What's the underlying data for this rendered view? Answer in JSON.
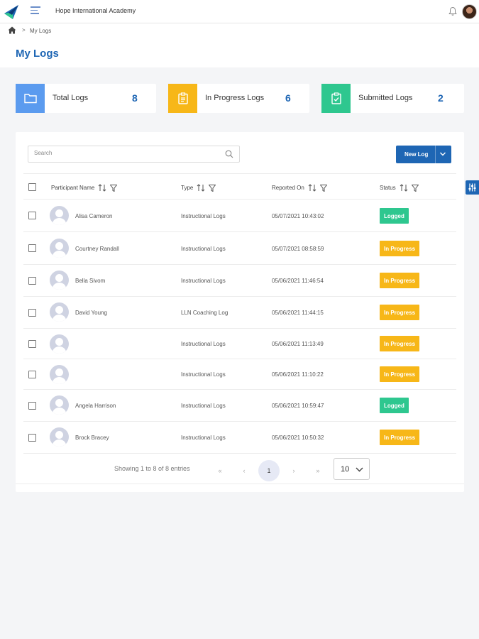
{
  "app": {
    "title": "Hope International Academy"
  },
  "breadcrumb": {
    "separator": ">",
    "current": "My Logs"
  },
  "page": {
    "title": "My Logs"
  },
  "stats": [
    {
      "label": "Total Logs",
      "value": "8",
      "color": "#5b9bef",
      "icon": "folder-icon"
    },
    {
      "label": "In Progress Logs",
      "value": "6",
      "color": "#f7b718",
      "icon": "clipboard-icon"
    },
    {
      "label": "Submitted Logs",
      "value": "2",
      "color": "#2ec78f",
      "icon": "clipboard-check-icon"
    }
  ],
  "search": {
    "placeholder": "Search"
  },
  "toolbar": {
    "new_log_label": "New Log"
  },
  "table": {
    "columns": [
      "Participant Name",
      "Type",
      "Reported On",
      "Status"
    ],
    "rows": [
      {
        "name": "Alisa Cameron",
        "type": "Instructional Logs",
        "reported": "05/07/2021 10:43:02",
        "status": "Logged"
      },
      {
        "name": "Courtney Randall",
        "type": "Instructional Logs",
        "reported": "05/07/2021 08:58:59",
        "status": "In Progress"
      },
      {
        "name": "Bella Sivom",
        "type": "Instructional Logs",
        "reported": "05/06/2021 11:46:54",
        "status": "In Progress"
      },
      {
        "name": "David Young",
        "type": "LLN Coaching Log",
        "reported": "05/06/2021 11:44:15",
        "status": "In Progress"
      },
      {
        "name": "",
        "type": "Instructional Logs",
        "reported": "05/06/2021 11:13:49",
        "status": "In Progress"
      },
      {
        "name": "",
        "type": "Instructional Logs",
        "reported": "05/06/2021 11:10:22",
        "status": "In Progress"
      },
      {
        "name": "Angela Harrison",
        "type": "Instructional Logs",
        "reported": "05/06/2021 10:59:47",
        "status": "Logged"
      },
      {
        "name": "Brock Bracey",
        "type": "Instructional Logs",
        "reported": "05/06/2021 10:50:32",
        "status": "In Progress"
      }
    ]
  },
  "status_colors": {
    "Logged": "#2ec78f",
    "In Progress": "#f7b718"
  },
  "pagination": {
    "info": "Showing 1 to 8 of 8 entries",
    "first": "«",
    "prev": "‹",
    "current": "1",
    "next": "›",
    "last": "»",
    "page_size": "10"
  },
  "colors": {
    "accent": "#1e66b4"
  }
}
